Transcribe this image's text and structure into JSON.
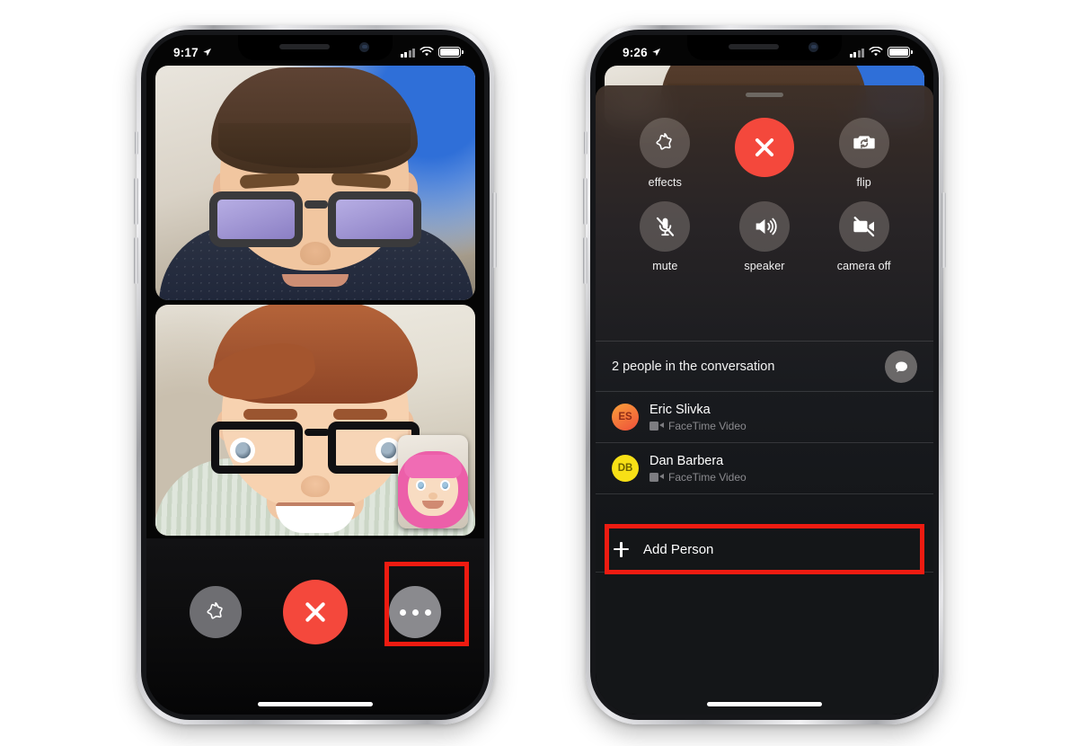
{
  "phones": {
    "left": {
      "name": "facetime-call-screen",
      "status_bar": {
        "time": "9:17",
        "location_icon": "location-arrow-icon",
        "signal_icon": "cellular-bars-icon",
        "wifi_icon": "wifi-icon",
        "battery_icon": "battery-icon"
      },
      "tiles": [
        {
          "participant_style": "memoji-sunglasses",
          "label": ""
        },
        {
          "participant_style": "memoji-glasses",
          "label": ""
        }
      ],
      "pip": {
        "style": "memoji-pink-hair"
      },
      "bottom_controls": [
        {
          "id": "effects",
          "icon": "effects-star-icon",
          "label": ""
        },
        {
          "id": "end-call",
          "icon": "close-x-icon",
          "label": ""
        },
        {
          "id": "more",
          "icon": "more-dots-icon",
          "label": ""
        }
      ],
      "annotation": {
        "target": "more-button",
        "color": "#ee1b11"
      }
    },
    "right": {
      "name": "facetime-controls-sheet",
      "status_bar": {
        "time": "9:26",
        "location_icon": "location-arrow-icon",
        "signal_icon": "cellular-bars-icon",
        "wifi_icon": "wifi-icon",
        "battery_icon": "battery-icon"
      },
      "controls": [
        {
          "id": "effects",
          "icon": "effects-star-icon",
          "label": "effects"
        },
        {
          "id": "end-call",
          "icon": "close-x-icon",
          "label": ""
        },
        {
          "id": "flip",
          "icon": "camera-flip-icon",
          "label": "flip"
        },
        {
          "id": "mute",
          "icon": "mic-muted-icon",
          "label": "mute"
        },
        {
          "id": "speaker",
          "icon": "speaker-icon",
          "label": "speaker"
        },
        {
          "id": "camera-off",
          "icon": "video-off-icon",
          "label": "camera off"
        }
      ],
      "participants_header": {
        "title": "2 people in the conversation",
        "message_icon": "message-bubble-icon"
      },
      "participants": [
        {
          "initials": "ES",
          "name": "Eric Slivka",
          "status": "FaceTime Video",
          "status_icon": "video-camera-icon",
          "avatar_color": "#ef4f3a"
        },
        {
          "initials": "DB",
          "name": "Dan Barbera",
          "status": "FaceTime Video",
          "status_icon": "video-camera-icon",
          "avatar_color": "#f7e016"
        }
      ],
      "add_person": {
        "label": "Add Person",
        "icon": "plus-icon"
      },
      "annotation": {
        "target": "add-person-row",
        "color": "#ee1b11"
      }
    }
  }
}
